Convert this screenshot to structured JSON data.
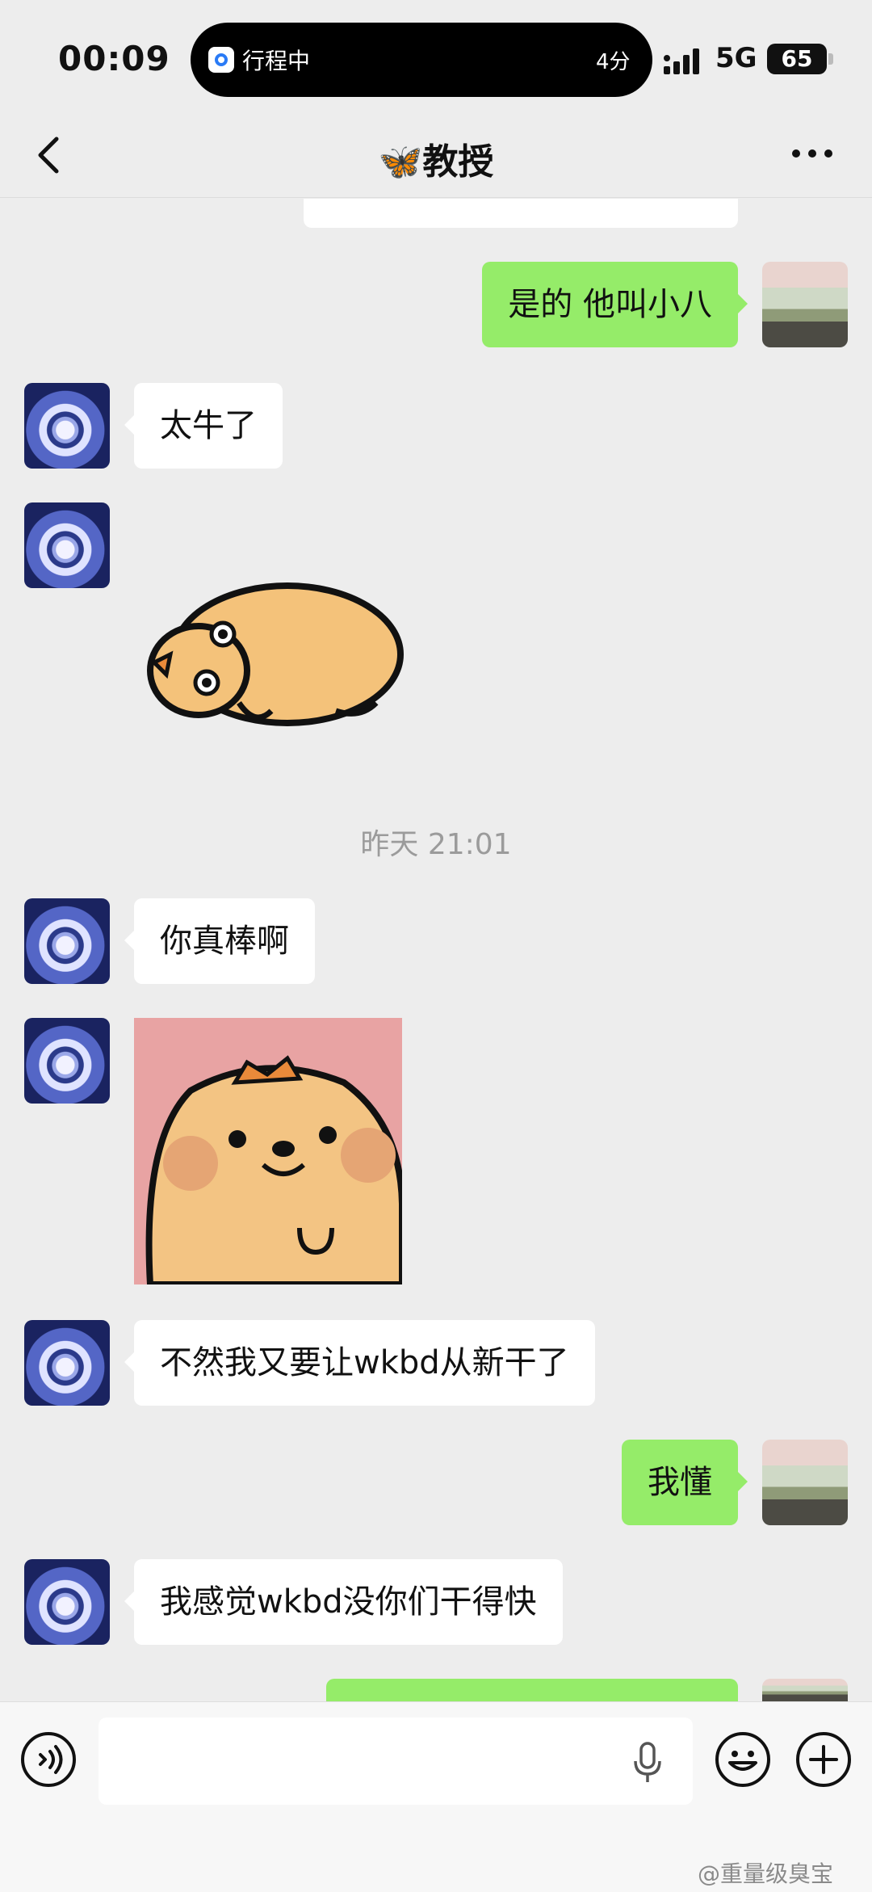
{
  "status_bar": {
    "time": "00:09",
    "island_text": "行程中",
    "island_minutes": "4分",
    "network": "5G",
    "battery": "65"
  },
  "header": {
    "title": "🦋教授"
  },
  "messages": [
    {
      "from": "me",
      "text": "是的 他叫小八"
    },
    {
      "from": "other",
      "text": "太牛了"
    },
    {
      "from": "other",
      "type": "sticker",
      "sticker": "lying-bear-sticker"
    },
    {
      "from": "other",
      "text": "你真棒啊"
    },
    {
      "from": "other",
      "type": "sticker",
      "sticker": "smiling-bear-sticker"
    },
    {
      "from": "other",
      "text": "不然我又要让wkbd从新干了"
    },
    {
      "from": "me",
      "text": "我懂"
    },
    {
      "from": "other",
      "text": "我感觉wkbd没你们干得快"
    }
  ],
  "timestamp": "昨天 21:01",
  "input": {
    "value": ""
  },
  "watermark": "@重量级臭宝",
  "colors": {
    "my_bubble": "#95ec69",
    "their_bubble": "#ffffff",
    "background": "#ededed"
  }
}
